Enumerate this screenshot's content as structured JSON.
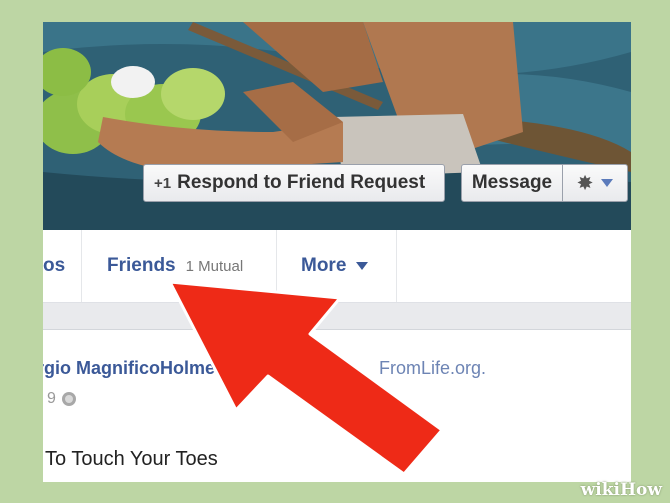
{
  "cover": {
    "respond_label": "Respond to Friend Request",
    "respond_icon": "+1",
    "message_label": "Message",
    "settings_icon": "gear-icon"
  },
  "tabs": {
    "photos_partial": "os",
    "friends_label": "Friends",
    "friends_mutual": "1 Mutual",
    "more_label": "More"
  },
  "post": {
    "author": "rgio MagnificoHolmes",
    "source": "FromLife.org.",
    "date": "l 9",
    "title": "To Touch Your Toes"
  },
  "colors": {
    "background": "#bdd6a4",
    "link_blue": "#3b5998",
    "arrow_red": "#ee2a17"
  },
  "watermark": "wikiHow"
}
